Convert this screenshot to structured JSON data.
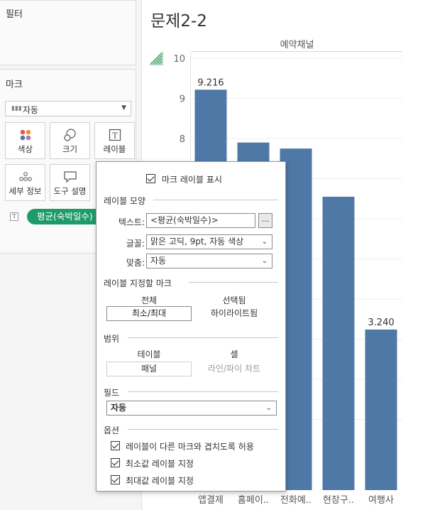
{
  "filters_card": {
    "title": "필터"
  },
  "marks_card": {
    "title": "마크",
    "mark_type": "자동",
    "buttons": [
      {
        "label": "색상",
        "icon": "color-dots-icon"
      },
      {
        "label": "크기",
        "icon": "size-circles-icon"
      },
      {
        "label": "레이블",
        "icon": "text-label-icon"
      },
      {
        "label": "세부 정보",
        "icon": "detail-dots-icon"
      },
      {
        "label": "도구 설명",
        "icon": "tooltip-bubble-icon"
      }
    ],
    "pill": {
      "label": "평균(숙박일수)",
      "icon": "text-t-icon"
    }
  },
  "sheet_title": "문제2-2",
  "chart_header": "예약채널",
  "chart_data": {
    "type": "bar",
    "title": "",
    "column_header": "예약채널",
    "categories": [
      "앱결제",
      "홈페이..",
      "전화예..",
      "현장구..",
      "여행사"
    ],
    "values": [
      9.216,
      7.9,
      7.75,
      6.55,
      3.24
    ],
    "data_labels": [
      "9.216",
      "",
      "",
      "",
      "3.240"
    ],
    "y_ticks": [
      "10",
      "9",
      "8"
    ],
    "ylim": [
      0,
      10.3
    ],
    "bar_color": "#4e79a7",
    "grid": true
  },
  "dialog": {
    "show_labels": "마크 레이블 표시",
    "appearance_title": "레이블 모양",
    "text_label": "텍스트:",
    "text_value": "<평균(숙박일수)>",
    "dots_label": "...",
    "font_label": "글꼴:",
    "font_value": "맑은 고딕, 9pt, 자동 색상",
    "align_label": "맞춤:",
    "align_value": "자동",
    "marks_to_label_title": "레이블 지정할 마크",
    "all_label": "전체",
    "selected_label": "선택됨",
    "min_max": "최소/최대",
    "highlighted": "하이라이트됨",
    "scope_title": "범위",
    "table_label": "테이블",
    "cell_label": "셀",
    "pane": "패널",
    "line_pie": "라인/파이 차트",
    "field_title": "필드",
    "field_value": "자동",
    "options_title": "옵션",
    "opt_overlap": "레이블이 다른 마크와 겹치도록 허용",
    "opt_min": "최소값 레이블 지정",
    "opt_max": "최대값 레이블 지정"
  }
}
